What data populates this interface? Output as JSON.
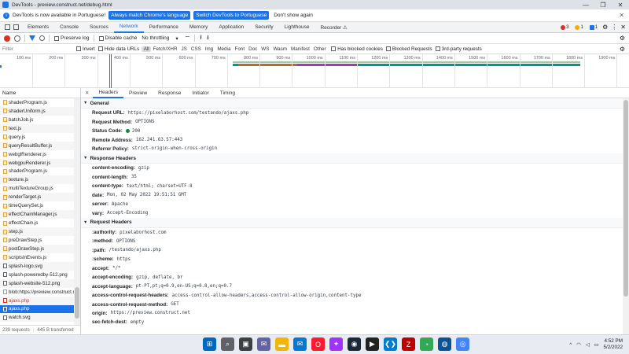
{
  "window": {
    "title": "DevTools - preview.construct.net/debug.html",
    "controls": [
      "—",
      "❐",
      "✕"
    ]
  },
  "infobar": {
    "message": "DevTools is now available in Portuguese!",
    "btn_match": "Always match Chrome's language",
    "btn_switch": "Switch DevTools to Portuguese",
    "btn_dont": "Don't show again",
    "close": "✕"
  },
  "devtools_tabs": [
    "Elements",
    "Console",
    "Sources",
    "Network",
    "Performance",
    "Memory",
    "Application",
    "Security",
    "Lighthouse",
    "Recorder ⚠"
  ],
  "active_tab": "Network",
  "badges": {
    "errors": "3",
    "warnings": "1",
    "issues": "1",
    "settings": "⚙",
    "more": "⋮",
    "close": "✕"
  },
  "net_toolbar": {
    "preserve_log": "Preserve log",
    "disable_cache": "Disable cache",
    "throttle": "No throttling",
    "throttle_arrow": "▾",
    "wifi": "⌔",
    "upload": "⭱",
    "download": "⭳",
    "settings": "⚙"
  },
  "filter_bar": {
    "placeholder": "Filter",
    "invert": "Invert",
    "hide_data_urls": "Hide data URLs",
    "types": [
      "All",
      "Fetch/XHR",
      "JS",
      "CSS",
      "Img",
      "Media",
      "Font",
      "Doc",
      "WS",
      "Wasm",
      "Manifest",
      "Other"
    ],
    "active_type": "All",
    "has_blocked_cookies": "Has blocked cookies",
    "blocked_requests": "Blocked Requests",
    "third_party": "3rd-party requests",
    "settings": "⚙"
  },
  "timeline": {
    "ticks": [
      "100 ms",
      "200 ms",
      "300 ms",
      "400 ms",
      "500 ms",
      "600 ms",
      "700 ms",
      "800 ms",
      "900 ms",
      "1000 ms",
      "1100 ms",
      "1200 ms",
      "1300 ms",
      "1400 ms",
      "1500 ms",
      "1600 ms",
      "1700 ms",
      "1800 ms",
      "1900 ms",
      "200"
    ]
  },
  "request_list": {
    "header": "Name",
    "items": [
      {
        "name": "shaderProgram.js",
        "type": "js"
      },
      {
        "name": "shaderUniform.js",
        "type": "js"
      },
      {
        "name": "batchJob.js",
        "type": "js"
      },
      {
        "name": "text.js",
        "type": "js"
      },
      {
        "name": "query.js",
        "type": "js"
      },
      {
        "name": "queryResultBuffer.js",
        "type": "js"
      },
      {
        "name": "webglRenderer.js",
        "type": "js"
      },
      {
        "name": "webgpuRenderer.js",
        "type": "js"
      },
      {
        "name": "shaderProgram.js",
        "type": "js"
      },
      {
        "name": "texture.js",
        "type": "js"
      },
      {
        "name": "multiTextureGroup.js",
        "type": "js"
      },
      {
        "name": "renderTarget.js",
        "type": "js"
      },
      {
        "name": "timeQuerySet.js",
        "type": "js"
      },
      {
        "name": "effectChainManager.js",
        "type": "js"
      },
      {
        "name": "effectChain.js",
        "type": "js"
      },
      {
        "name": "step.js",
        "type": "js"
      },
      {
        "name": "preDrawStep.js",
        "type": "js"
      },
      {
        "name": "postDrawStep.js",
        "type": "js"
      },
      {
        "name": "scriptsInEvents.js",
        "type": "js"
      },
      {
        "name": "splash-logo.svg",
        "type": "img"
      },
      {
        "name": "splash-poweredby-512.png",
        "type": "img"
      },
      {
        "name": "splash-website-512.png",
        "type": "img"
      },
      {
        "name": "blob:https://preview.construct.net/...",
        "type": "fetch"
      },
      {
        "name": "ajaxs.php",
        "type": "error"
      },
      {
        "name": "ajaxs.php",
        "type": "selected"
      },
      {
        "name": "watch.svg",
        "type": "img"
      }
    ],
    "status_requests": "239 requests",
    "status_transferred": "445 B transferred"
  },
  "detail_tabs": [
    "Headers",
    "Preview",
    "Response",
    "Initiator",
    "Timing"
  ],
  "active_detail_tab": "Headers",
  "general": {
    "title": "General",
    "rows": [
      {
        "k": "Request URL:",
        "v": "https://pixelaborhost.com/testando/ajaxs.php"
      },
      {
        "k": "Request Method:",
        "v": "OPTIONS"
      },
      {
        "k": "Status Code:",
        "v": "200",
        "status": true
      },
      {
        "k": "Remote Address:",
        "v": "162.241.63.57:443"
      },
      {
        "k": "Referrer Policy:",
        "v": "strict-origin-when-cross-origin"
      }
    ]
  },
  "response_headers": {
    "title": "Response Headers",
    "rows": [
      {
        "k": "content-encoding:",
        "v": "gzip"
      },
      {
        "k": "content-length:",
        "v": "35"
      },
      {
        "k": "content-type:",
        "v": "text/html; charset=UTF-8"
      },
      {
        "k": "date:",
        "v": "Mon, 02 May 2022 19:51:51 GMT"
      },
      {
        "k": "server:",
        "v": "Apache"
      },
      {
        "k": "vary:",
        "v": "Accept-Encoding"
      }
    ]
  },
  "request_headers": {
    "title": "Request Headers",
    "rows": [
      {
        "k": ":authority:",
        "v": "pixelaborhost.com"
      },
      {
        "k": ":method:",
        "v": "OPTIONS"
      },
      {
        "k": ":path:",
        "v": "/testando/ajaxs.php"
      },
      {
        "k": ":scheme:",
        "v": "https"
      },
      {
        "k": "accept:",
        "v": "*/*"
      },
      {
        "k": "accept-encoding:",
        "v": "gzip, deflate, br"
      },
      {
        "k": "accept-language:",
        "v": "pt-PT,pt;q=0.9,en-US;q=0.8,en;q=0.7"
      },
      {
        "k": "access-control-request-headers:",
        "v": "access-control-allow-headers,access-control-allow-origin,content-type"
      },
      {
        "k": "access-control-request-method:",
        "v": "GET"
      },
      {
        "k": "origin:",
        "v": "https://preview.construct.net"
      },
      {
        "k": "sec-fetch-dest:",
        "v": "empty"
      }
    ]
  },
  "taskbar": {
    "apps": [
      {
        "icon": "windows-start-icon",
        "glyph": "⊞",
        "color": "#0067c0"
      },
      {
        "icon": "search-icon",
        "glyph": "⌕",
        "color": "#5f6368"
      },
      {
        "icon": "task-view-icon",
        "glyph": "▣",
        "color": "#3c4043"
      },
      {
        "icon": "chat-icon",
        "glyph": "✉",
        "color": "#6264a7"
      },
      {
        "icon": "file-explorer-icon",
        "glyph": "▬",
        "color": "#f4b400"
      },
      {
        "icon": "mail-icon",
        "glyph": "✉",
        "color": "#0078d4"
      },
      {
        "icon": "opera-icon",
        "glyph": "O",
        "color": "#ff1b2d"
      },
      {
        "icon": "messenger-icon",
        "glyph": "✦",
        "color": "#a033ff"
      },
      {
        "icon": "steam-icon",
        "glyph": "◉",
        "color": "#1b2838"
      },
      {
        "icon": "media-icon",
        "glyph": "▶",
        "color": "#222"
      },
      {
        "icon": "vscode-icon",
        "glyph": "❮❯",
        "color": "#007acc"
      },
      {
        "icon": "filezilla-icon",
        "glyph": "Z",
        "color": "#bf0000"
      },
      {
        "icon": "chart-app-icon",
        "glyph": "◔",
        "color": "#34a853"
      },
      {
        "icon": "network-app-icon",
        "glyph": "◍",
        "color": "#0b5394"
      },
      {
        "icon": "chrome-icon",
        "glyph": "◎",
        "color": "#4285f4"
      }
    ],
    "tray_chevron": "^",
    "time": "4:52 PM",
    "date": "5/2/2022"
  }
}
